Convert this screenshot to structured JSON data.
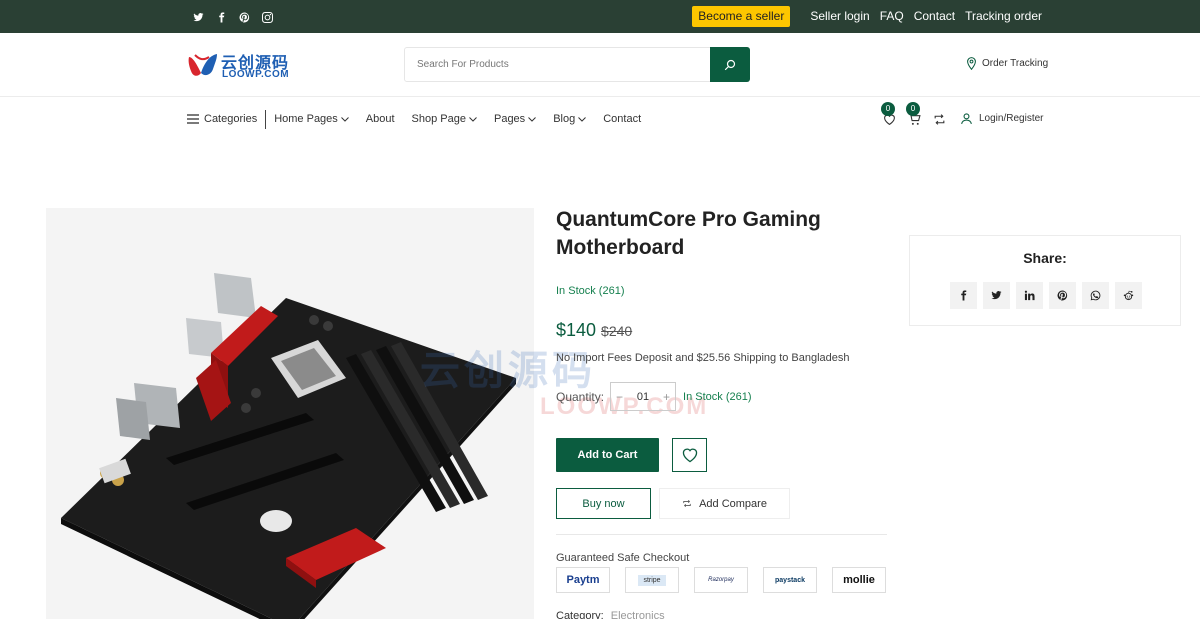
{
  "topbar": {
    "social_icons": [
      "twitter-icon",
      "facebook-icon",
      "pinterest-icon",
      "instagram-icon"
    ],
    "become_seller": "Become a seller",
    "links": [
      "Seller login",
      "FAQ",
      "Contact",
      "Tracking order"
    ]
  },
  "header": {
    "logo_cn": "云创源码",
    "logo_en": "LOOWP.COM",
    "search_placeholder": "Search For Products",
    "order_tracking": "Order Tracking"
  },
  "nav": {
    "categories": "Categories",
    "items": [
      "Home Pages",
      "About",
      "Shop Page",
      "Pages",
      "Blog",
      "Contact"
    ],
    "wishlist_count": "0",
    "cart_count": "0",
    "login": "Login/Register"
  },
  "product": {
    "title": "QuantumCore Pro Gaming Motherboard",
    "in_stock": "In Stock (261)",
    "price": "$140",
    "old_price": "$240",
    "shipping": "No Import Fees Deposit and $25.56 Shipping to Bangladesh",
    "quantity_label": "Quantity:",
    "quantity_value": "01",
    "quantity_stock": "In Stock (261)",
    "add_to_cart": "Add to Cart",
    "buy_now": "Buy now",
    "add_compare": "Add Compare",
    "guaranteed": "Guaranteed Safe Checkout",
    "payments": [
      "Paytm",
      "stripe",
      "Razorpay",
      "paystack",
      "mollie"
    ],
    "category_label": "Category:",
    "category_value": "Electronics"
  },
  "share": {
    "title": "Share:",
    "icons": [
      "facebook-icon",
      "twitter-icon",
      "linkedin-icon",
      "pinterest-icon",
      "whatsapp-icon",
      "reddit-icon"
    ]
  },
  "watermark": {
    "cn": "云创源码",
    "en": "LOOWP.COM"
  },
  "colors": {
    "topbar": "#2a4034",
    "accent": "#0b5c3f",
    "seller_button": "#fdc600",
    "stock": "#16804f"
  }
}
